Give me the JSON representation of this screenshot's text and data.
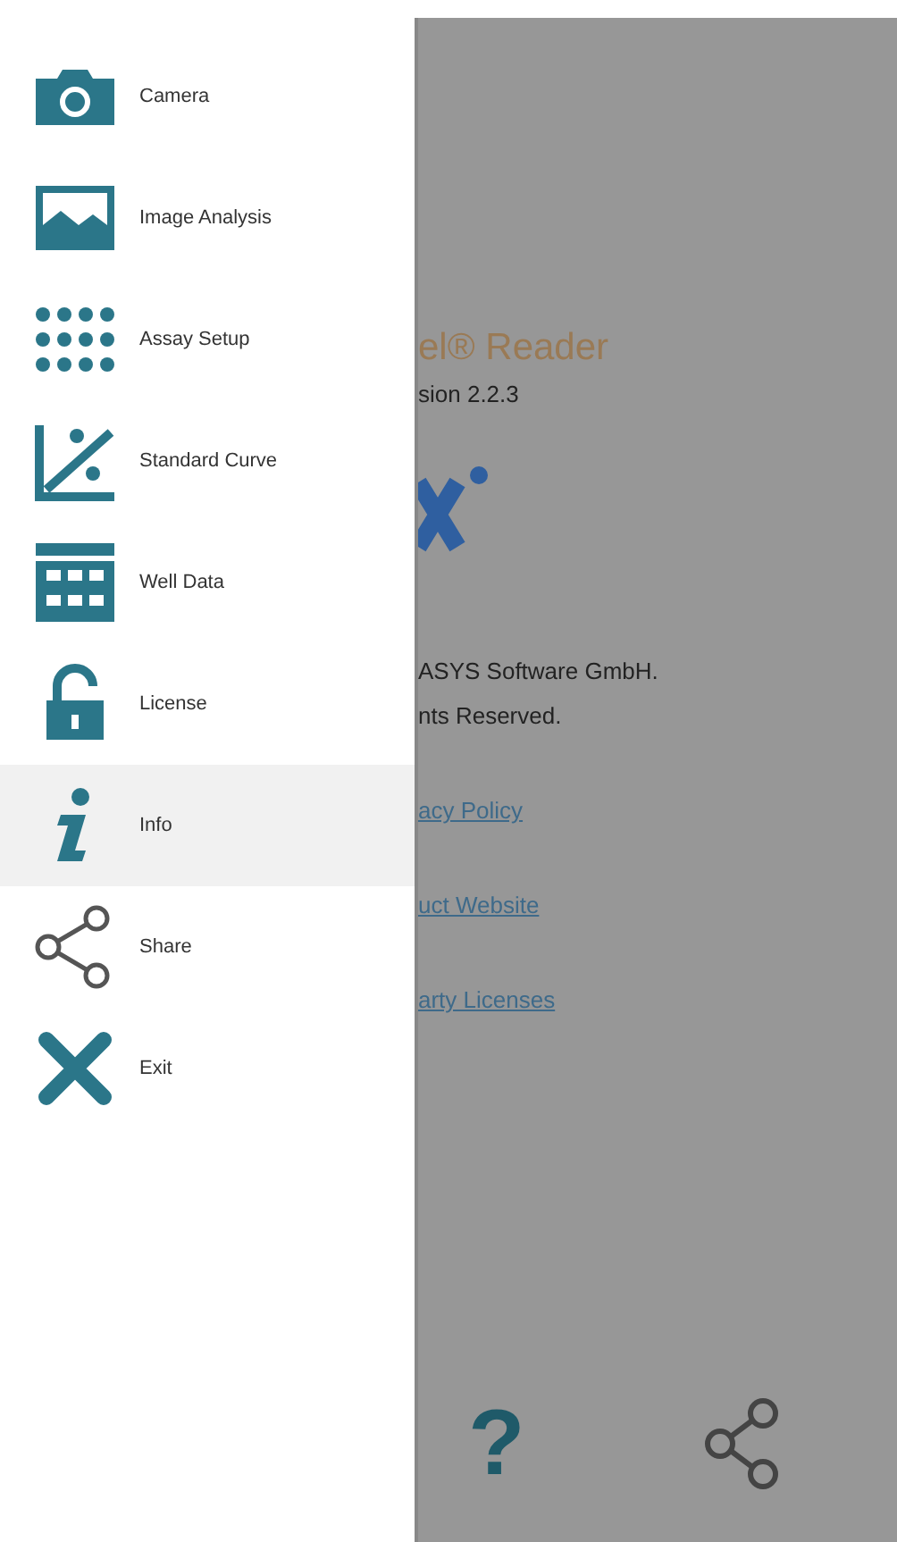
{
  "drawer": {
    "items": [
      {
        "kind": "camera",
        "label": "Camera",
        "selected": false
      },
      {
        "kind": "image",
        "label": "Image Analysis",
        "selected": false
      },
      {
        "kind": "grid",
        "label": "Assay Setup",
        "selected": false
      },
      {
        "kind": "curve",
        "label": "Standard Curve",
        "selected": false
      },
      {
        "kind": "table",
        "label": "Well Data",
        "selected": false
      },
      {
        "kind": "lock",
        "label": "License",
        "selected": false
      },
      {
        "kind": "info",
        "label": "Info",
        "selected": true
      },
      {
        "kind": "share",
        "label": "Share",
        "selected": false
      },
      {
        "kind": "exit",
        "label": "Exit",
        "selected": false
      }
    ]
  },
  "about": {
    "title": "el® Reader",
    "version": "sion 2.2.3",
    "copyright": [
      "ASYS Software GmbH.",
      "nts Reserved."
    ],
    "links": [
      "acy Policy",
      "uct Website",
      "arty Licenses"
    ]
  },
  "bottom_bar": {
    "help": "?"
  }
}
